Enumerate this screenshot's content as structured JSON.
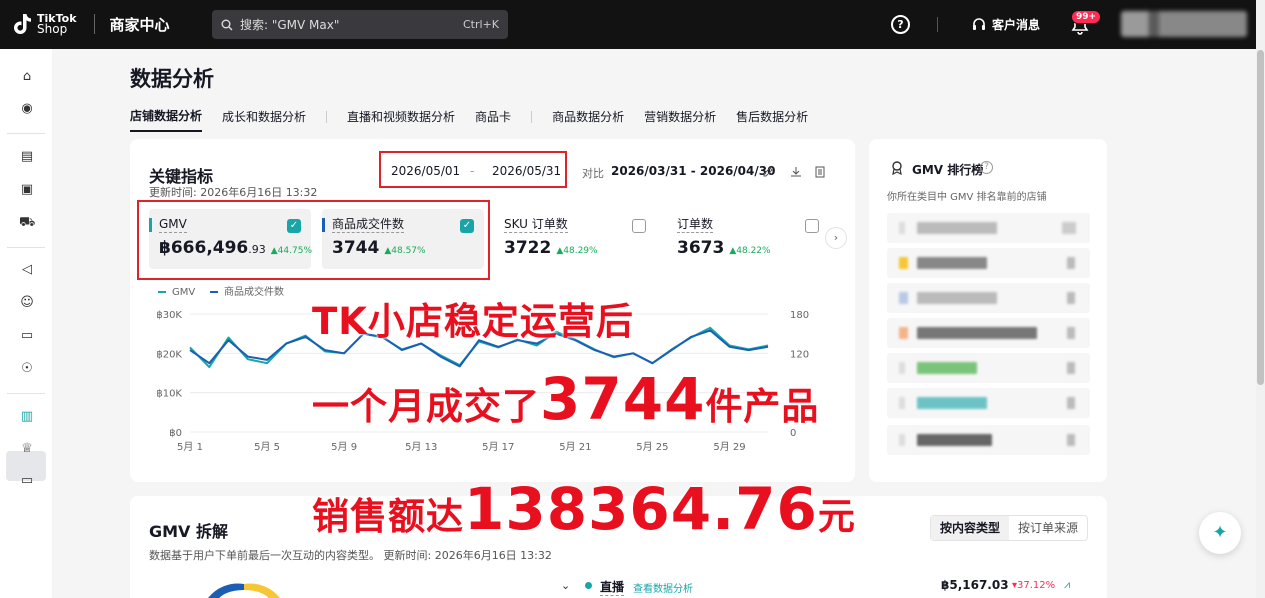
{
  "brand": {
    "logo_line1": "TikTok",
    "logo_line2": "Shop",
    "center": "商家中心"
  },
  "search": {
    "text": "搜索: \"GMV Max\"",
    "shortcut": "Ctrl+K"
  },
  "header": {
    "help": "?",
    "messages": "客户消息",
    "badge": "99+"
  },
  "page": {
    "title": "数据分析"
  },
  "tabs": [
    "店铺数据分析",
    "成长和数据分析",
    "直播和视频数据分析",
    "商品卡",
    "商品数据分析",
    "营销数据分析",
    "售后数据分析"
  ],
  "metrics": {
    "title": "关键指标",
    "updated": "更新时间: 2026年6月16日 13:32",
    "date_start": "2026/05/01",
    "date_sep": "-",
    "date_end": "2026/05/31",
    "compare_label": "对比",
    "compare_range": "2026/03/31 - 2026/04/30",
    "kpis": [
      {
        "label": "GMV",
        "value": "฿666,496",
        "decimals": ".93",
        "change": "▲44.75%",
        "checked": true,
        "color": "#18a5a8"
      },
      {
        "label": "商品成交件数",
        "value": "3744",
        "decimals": "",
        "change": "▲48.57%",
        "checked": true,
        "color": "#1a5fb4"
      },
      {
        "label": "SKU 订单数",
        "value": "3722",
        "decimals": "",
        "change": "▲48.29%",
        "checked": false,
        "color": ""
      },
      {
        "label": "订单数",
        "value": "3673",
        "decimals": "",
        "change": "▲48.22%",
        "checked": false,
        "color": ""
      }
    ]
  },
  "chart_data": {
    "type": "line",
    "x": [
      "5月1",
      "5月2",
      "5月3",
      "5月4",
      "5月5",
      "5月6",
      "5月7",
      "5月8",
      "5月9",
      "5月10",
      "5月11",
      "5月12",
      "5月13",
      "5月14",
      "5月15",
      "5月16",
      "5月17",
      "5月18",
      "5月19",
      "5月20",
      "5月21",
      "5月22",
      "5月23",
      "5月24",
      "5月25",
      "5月26",
      "5月27",
      "5月28",
      "5月29",
      "5月30",
      "5月31"
    ],
    "x_ticks": [
      "5月 1",
      "5月 5",
      "5月 9",
      "5月 13",
      "5月 17",
      "5月 21",
      "5月 25",
      "5月 29"
    ],
    "series": [
      {
        "name": "GMV",
        "axis": "left",
        "color": "#18a5a8",
        "values": [
          21500,
          16500,
          24000,
          18500,
          17500,
          22500,
          24500,
          20500,
          20000,
          25000,
          24000,
          21000,
          22500,
          19500,
          17000,
          23000,
          21500,
          23500,
          22000,
          25500,
          23500,
          21000,
          19000,
          20000,
          17500,
          21000,
          24000,
          26500,
          22000,
          21000,
          22000
        ]
      },
      {
        "name": "商品成交件数",
        "axis": "right",
        "color": "#1a5fb4",
        "values": [
          125,
          105,
          140,
          115,
          110,
          135,
          145,
          125,
          120,
          150,
          145,
          125,
          135,
          115,
          100,
          140,
          130,
          140,
          135,
          150,
          140,
          125,
          115,
          120,
          105,
          125,
          145,
          155,
          130,
          125,
          130
        ]
      }
    ],
    "y_left_ticks": [
      "฿0",
      "฿10K",
      "฿20K",
      "฿30K"
    ],
    "y_left_range": [
      0,
      30000
    ],
    "y_right_ticks": [
      "0",
      "120",
      "180"
    ],
    "y_right_range": [
      0,
      180
    ],
    "legend_position": "top-left",
    "grid": true
  },
  "overlay": {
    "line1": "TK小店稳定运营后",
    "line2a": "一个月成交了",
    "line2b": "3744",
    "line2c": "件产品",
    "line3a": "销售额达",
    "line3b": "138364.76",
    "line3c": "元"
  },
  "ranking": {
    "title": "GMV 排行榜",
    "subtitle": "你所在类目中 GMV 排名靠前的店铺"
  },
  "breakdown": {
    "title": "GMV 拆解",
    "subtitle": "数据基于用户下单前最后一次互动的内容类型。 更新时间: 2026年6月16日 13:32",
    "toggle": [
      "按内容类型",
      "按订单来源"
    ],
    "row_label": "直播",
    "row_link": "查看数据分析",
    "row_value": "฿5,167.03",
    "row_change": "▾37.12%"
  },
  "colors": {
    "accent": "#18a5a8",
    "secondary": "#1a5fb4",
    "overlay_red": "#e8101e",
    "up": "#1aab5a",
    "down": "#fe2c55"
  }
}
